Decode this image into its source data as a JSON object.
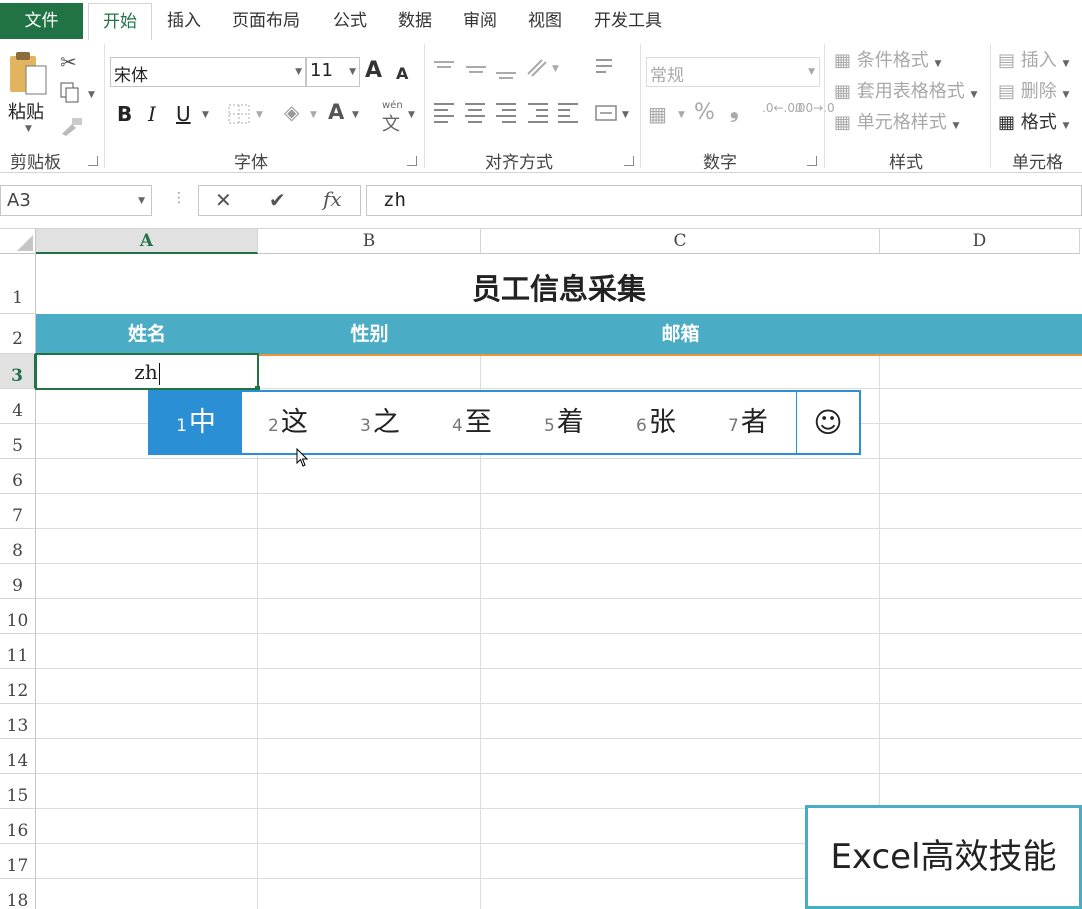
{
  "ribbon": {
    "tabs": [
      {
        "label": "文件",
        "active": false
      },
      {
        "label": "开始",
        "active": true
      },
      {
        "label": "插入",
        "active": false
      },
      {
        "label": "页面布局",
        "active": false
      },
      {
        "label": "公式",
        "active": false
      },
      {
        "label": "数据",
        "active": false
      },
      {
        "label": "审阅",
        "active": false
      },
      {
        "label": "视图",
        "active": false
      },
      {
        "label": "开发工具",
        "active": false
      }
    ],
    "clipboard": {
      "paste_label": "粘贴",
      "group_label": "剪贴板"
    },
    "font": {
      "name": "宋体",
      "size": "11",
      "grow_label": "A",
      "shrink_label": "A",
      "bold": "B",
      "italic": "I",
      "underline": "U",
      "font_color": "A",
      "phonetic_top": "wén",
      "phonetic_bottom": "文",
      "group_label": "字体"
    },
    "alignment": {
      "group_label": "对齐方式"
    },
    "number": {
      "format": "常规",
      "percent": "%",
      "comma": "❟",
      "inc_decimal": ".0←.00",
      "dec_decimal": ".00→.0",
      "group_label": "数字"
    },
    "styles": {
      "conditional": "条件格式",
      "table_format": "套用表格格式",
      "cell_style": "单元格样式",
      "group_label": "样式"
    },
    "cells": {
      "insert": "插入",
      "delete": "删除",
      "format": "格式",
      "group_label": "单元格"
    }
  },
  "formula_bar": {
    "name_box": "A3",
    "cancel": "✕",
    "enter": "✔",
    "fx": "fx",
    "content": "zh"
  },
  "grid": {
    "columns": [
      "A",
      "B",
      "C",
      "D"
    ],
    "rows": [
      "1",
      "2",
      "3",
      "4",
      "5",
      "6",
      "7",
      "8",
      "9",
      "10",
      "11",
      "12",
      "13",
      "14",
      "15",
      "16",
      "17",
      "18"
    ],
    "title": "员工信息采集",
    "headers": [
      "姓名",
      "性别",
      "邮箱"
    ],
    "active_cell_text": "zh"
  },
  "ime": {
    "candidates": [
      {
        "num": "1",
        "text": "中"
      },
      {
        "num": "2",
        "text": "这"
      },
      {
        "num": "3",
        "text": "之"
      },
      {
        "num": "4",
        "text": "至"
      },
      {
        "num": "5",
        "text": "着"
      },
      {
        "num": "6",
        "text": "张"
      },
      {
        "num": "7",
        "text": "者"
      }
    ],
    "emoji": "☺"
  },
  "watermark": "Excel高效技能",
  "colors": {
    "excel_green": "#217346",
    "header_band": "#4bacc6",
    "ime_blue": "#2b8fd6",
    "accent_orange": "#e7963b"
  }
}
